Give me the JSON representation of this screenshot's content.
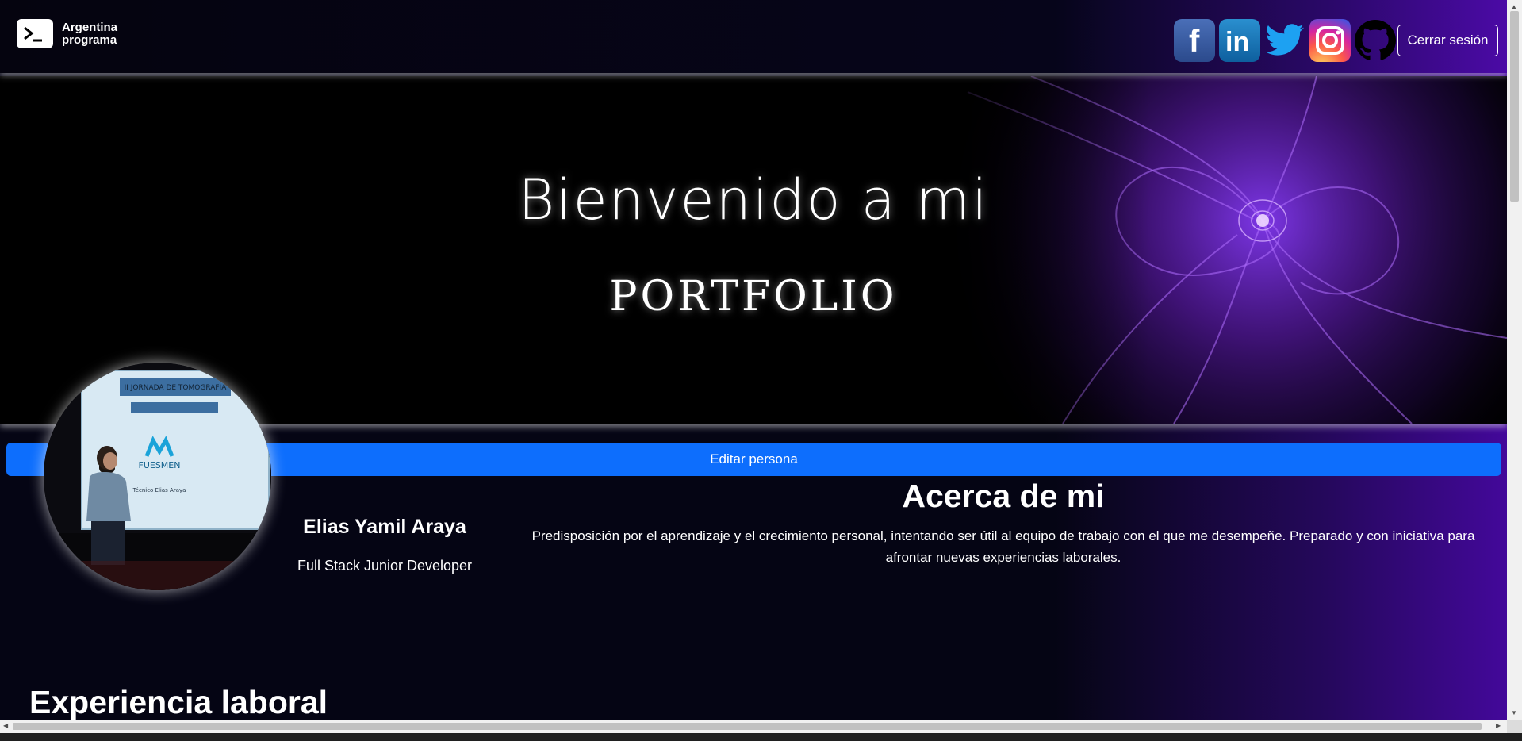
{
  "navbar": {
    "logo_line1": "Argentina",
    "logo_line2": "programa",
    "socials": [
      {
        "name": "facebook-icon"
      },
      {
        "name": "linkedin-icon"
      },
      {
        "name": "twitter-icon"
      },
      {
        "name": "instagram-icon"
      },
      {
        "name": "github-icon"
      }
    ],
    "logout_label": "Cerrar sesión"
  },
  "hero": {
    "title": "Bienvenido a mi",
    "subtitle": "PORTFOLIO"
  },
  "profile": {
    "edit_label": "Editar persona",
    "name": "Elias Yamil Araya",
    "role": "Full Stack Junior Developer",
    "photo_caption": "FUESMEN",
    "photo_banner": "II JORNADA DE TOMOGRAFIA",
    "photo_footer": "Técnico Elias Araya"
  },
  "about": {
    "title": "Acerca de mi",
    "text": "Predisposición por el aprendizaje y el crecimiento personal, intentando ser útil al equipo de trabajo con el que me desempeñe. Preparado y con iniciativa para afrontar nuevas experiencias laborales."
  },
  "experience": {
    "title": "Experiencia laboral"
  },
  "colors": {
    "accent": "#0d6efd",
    "purple": "#4b0aa6",
    "background": "#050514"
  }
}
